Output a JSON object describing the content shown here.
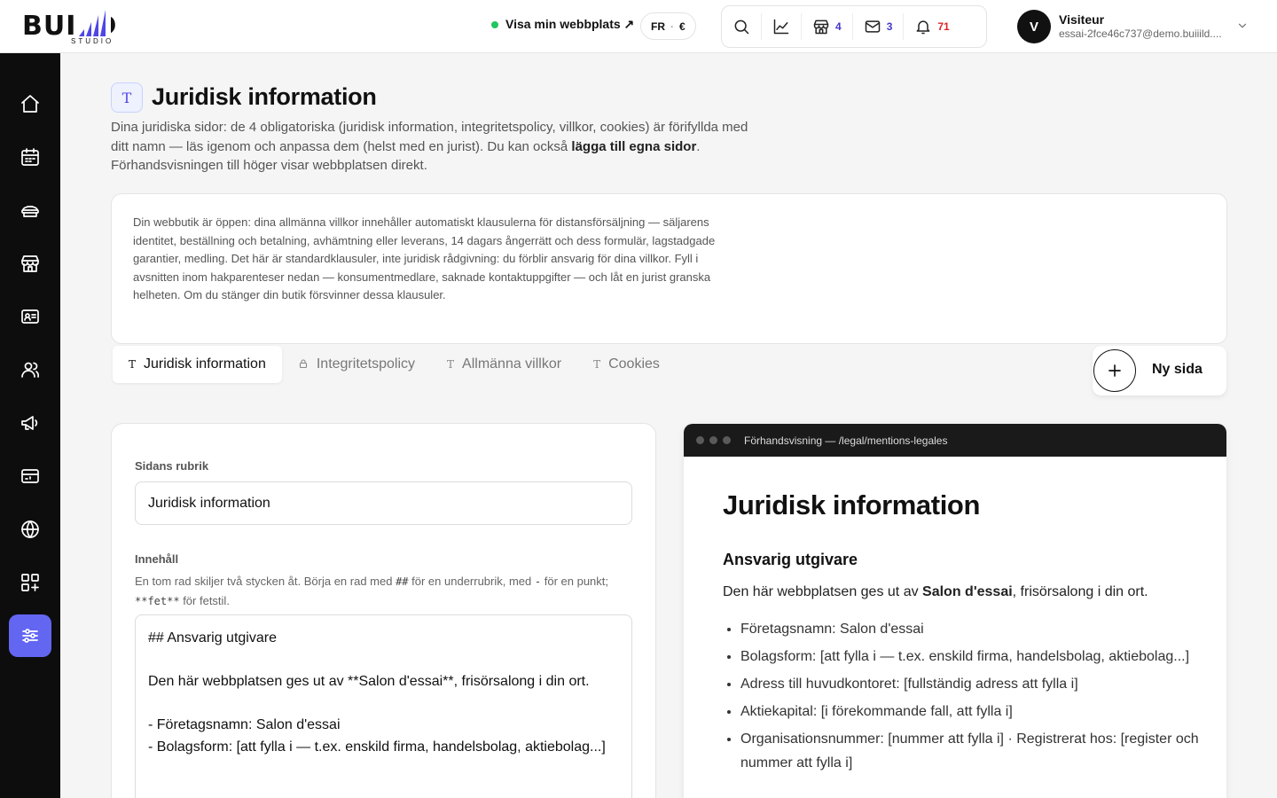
{
  "brand": {
    "name": "BUILD",
    "sub": "STUDIO"
  },
  "topbar": {
    "visit_link": "Visa min webbplats ↗",
    "lang": "FR",
    "lang_sep": "·",
    "currency": "€",
    "shop_count": "4",
    "mail_count": "3",
    "notif_count": "71",
    "user_initial": "V",
    "user_name": "Visiteur",
    "user_email": "essai-2fce46c737@demo.buiiild...."
  },
  "header": {
    "icon": "T",
    "title": "Juridisk information",
    "desc_part1": "Dina juridiska sidor: de 4 obligatoriska (juridisk information, integritetspolicy, villkor, cookies) är förifyllda med ditt namn — läs igenom och anpassa dem (helst med en jurist). Du kan också ",
    "desc_bold": "lägga till egna sidor",
    "desc_part2": ". Förhandsvisningen till höger visar webbplatsen direkt."
  },
  "notice": "Din webbutik är öppen: dina allmänna villkor innehåller automatiskt klausulerna för distansförsäljning — säljarens identitet, beställning och betalning, avhämtning eller leverans, 14 dagars ångerrätt och dess formulär, lagstadgade garantier, medling. Det här är standardklausuler, inte juridisk rådgivning: du förblir ansvarig för dina villkor. Fyll i avsnitten inom hakparenteser nedan — konsumentmedlare, saknade kontaktuppgifter — och låt en jurist granska helheten. Om du stänger din butik försvinner dessa klausuler.",
  "tabs": [
    {
      "icon": "T",
      "label": "Juridisk information"
    },
    {
      "icon": "🔒",
      "label": "Integritetspolicy"
    },
    {
      "icon": "T",
      "label": "Allmänna villkor"
    },
    {
      "icon": "T",
      "label": "Cookies"
    }
  ],
  "new_page_label": "Ny sida",
  "editor": {
    "title_label": "Sidans rubrik",
    "title_value": "Juridisk information",
    "content_label": "Innehåll",
    "help_part1": "En tom rad skiljer två stycken åt. Börja en rad med ",
    "help_code1": "##",
    "help_part2": " för en underrubrik, med ",
    "help_code2": "-",
    "help_part3": " för en punkt; ",
    "help_code3": "**fet**",
    "help_part4": " för fetstil.",
    "content_value": "## Ansvarig utgivare\n\nDen här webbplatsen ges ut av **Salon d'essai**, frisörsalong i din ort.\n\n- Företagsnamn: Salon d'essai\n- Bolagsform: [att fylla i — t.ex. enskild firma, handelsbolag, aktiebolag...]"
  },
  "preview": {
    "url": "Förhandsvisning — /legal/mentions-legales",
    "h1": "Juridisk information",
    "h2": "Ansvarig utgivare",
    "p_before": "Den här webbplatsen ges ut av ",
    "p_bold": "Salon d'essai",
    "p_after": ", frisörsalong i din ort.",
    "items": [
      "Företagsnamn: Salon d'essai",
      "Bolagsform: [att fylla i — t.ex. enskild firma, handelsbolag, aktiebolag...]",
      "Adress till huvudkontoret: [fullständig adress att fylla i]",
      "Aktiekapital: [i förekommande fall, att fylla i]",
      "Organisationsnummer: [nummer att fylla i] · Registrerat hos: [register och nummer att fylla i]"
    ]
  },
  "colors": {
    "accent": "#6366f1",
    "online": "#22c55e",
    "count_blue": "#4338ca",
    "count_red": "#dc2626"
  }
}
